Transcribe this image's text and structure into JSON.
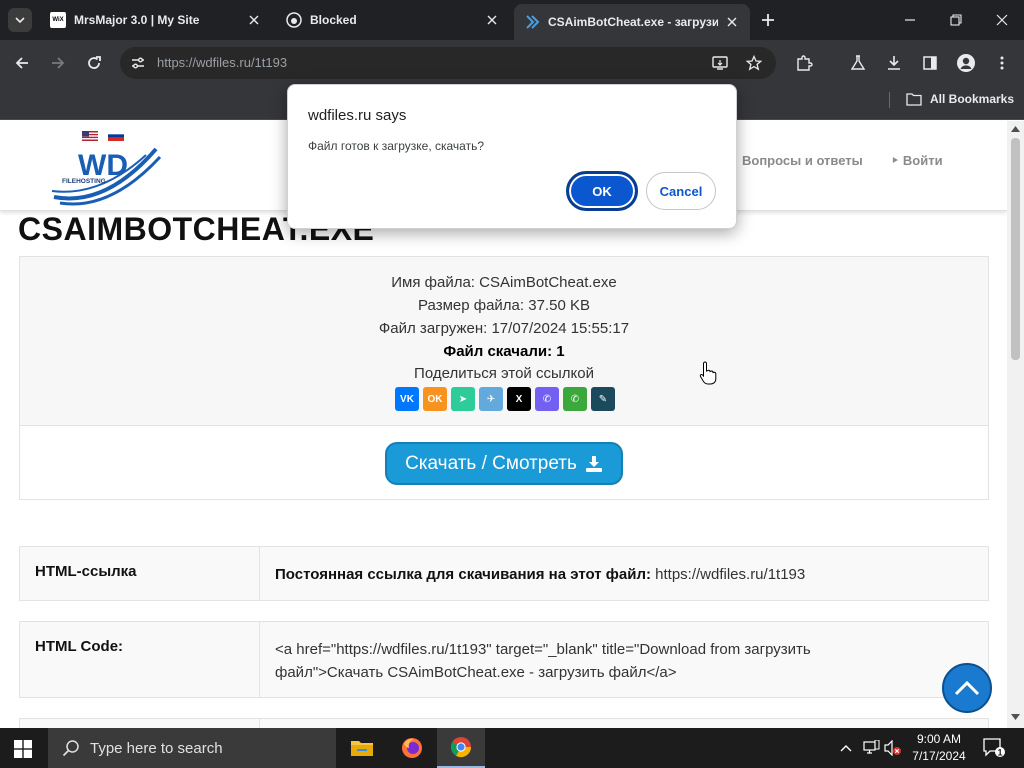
{
  "browser": {
    "tabs": [
      {
        "title": "MrsMajor 3.0 | My Site",
        "favicon": "wix-icon",
        "favicon_text": "WiX"
      },
      {
        "title": "Blocked",
        "favicon": "github-icon"
      },
      {
        "title": "CSAimBotCheat.exe - загрузить",
        "favicon": "wdfiles-icon",
        "active": true
      }
    ],
    "url_host": "https://wdfiles.ru",
    "url_path": "/1t193",
    "bookmarks_all_label": "All Bookmarks"
  },
  "dialog": {
    "title": "wdfiles.ru says",
    "message": "Файл готов к загрузке, скачать?",
    "ok_label": "OK",
    "cancel_label": "Cancel"
  },
  "site": {
    "logo_text": "WD",
    "logo_subtext": "FILEHOSTING",
    "nav": [
      "Вопросы и ответы",
      "Войти"
    ],
    "nav_prefix": "‣ ",
    "file_title": "CSAIMBOTCHEAT.EXE",
    "info": {
      "name_label": "Имя файла:",
      "name_value": "CSAimBotCheat.exe",
      "size_label": "Размер файла:",
      "size_value": "37.50 KB",
      "uploaded_label": "Файл загружен:",
      "uploaded_value": "17/07/2024 15:55:17",
      "downloads_label": "Файл скачали:",
      "downloads_value": "1",
      "share_label": "Поделиться этой ссылкой"
    },
    "share_icons": [
      {
        "name": "vk-icon",
        "text": "VK",
        "color": "#0077ff"
      },
      {
        "name": "odnoklassniki-icon",
        "text": "OK",
        "color": "#f7931e"
      },
      {
        "name": "messenger-icon",
        "text": "➤",
        "color": "#2ecc9a"
      },
      {
        "name": "telegram-icon",
        "text": "✈",
        "color": "#64a9dc"
      },
      {
        "name": "x-icon",
        "text": "X",
        "color": "#000000"
      },
      {
        "name": "viber-icon",
        "text": "✆",
        "color": "#7360f2"
      },
      {
        "name": "whatsapp-icon",
        "text": "✆",
        "color": "#3aa83a"
      },
      {
        "name": "livejournal-icon",
        "text": "✎",
        "color": "#1b4a5c"
      }
    ],
    "download_button": "Скачать / Смотреть",
    "rows": [
      {
        "label": "HTML-ссылка",
        "value_bold": "Постоянная ссылка для скачивания на этот файл:",
        "value": " https://wdfiles.ru/1t193"
      },
      {
        "label": "HTML Code:",
        "value_line1": "<a href=\"https://wdfiles.ru/1t193\" target=\"_blank\" title=\"Download from загрузить",
        "value_line2": "файл\">Скачать CSAimBotCheat.exe - загрузить файл</a>"
      }
    ]
  },
  "taskbar": {
    "search_placeholder": "Type here to search",
    "time": "9:00 AM",
    "date": "7/17/2024",
    "notification_count": "1"
  },
  "colors": {
    "accent": "#1a9ad6",
    "dialog_ok": "#0b57d0",
    "chrome_dark": "#202124"
  }
}
